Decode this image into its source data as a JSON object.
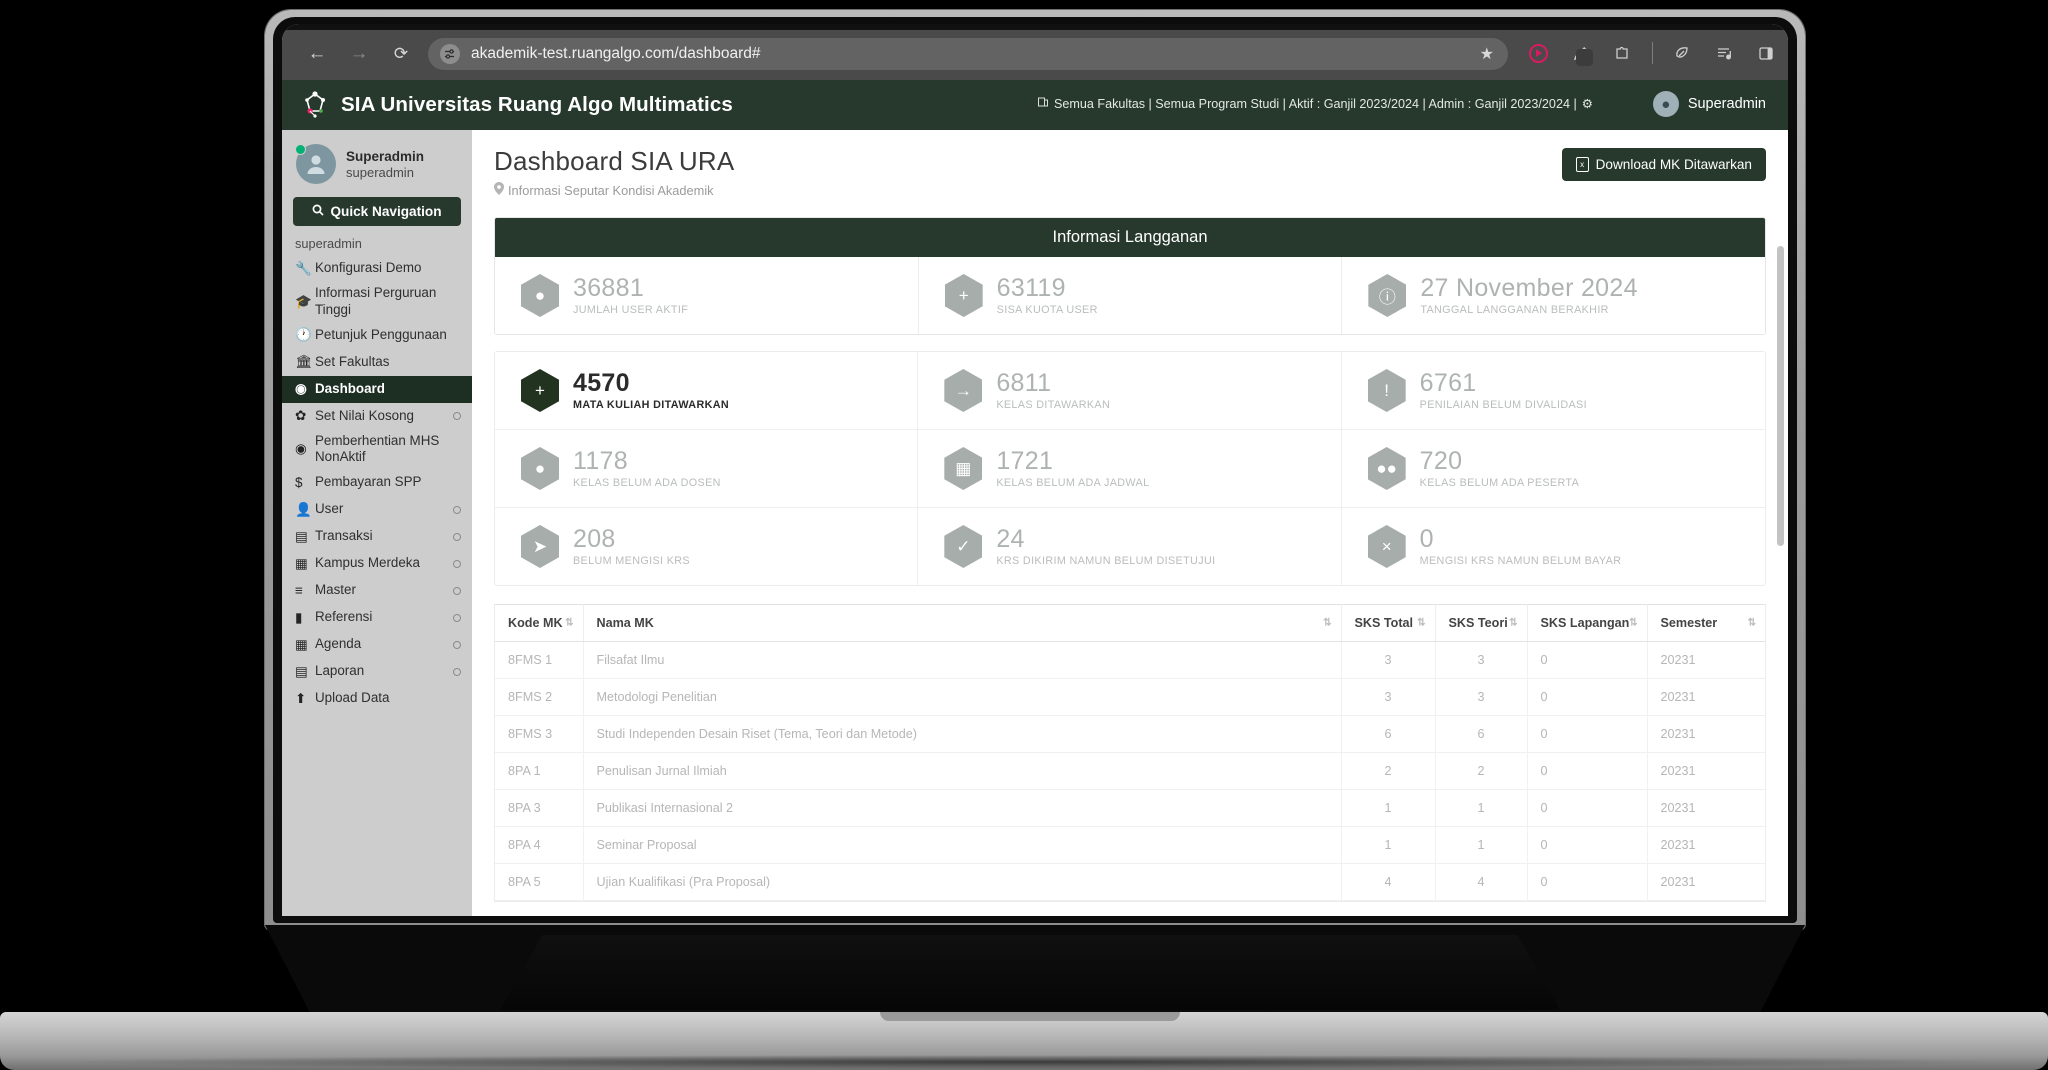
{
  "browser": {
    "back_icon": "←",
    "forward_icon": "→",
    "reload_icon": "⟳",
    "site_icon": "site-settings-icon",
    "url": "akademik-test.ruangalgo.com/dashboard#",
    "star_icon": "★",
    "extensions": [
      "record-icon",
      "pen-icon",
      "puzzle-icon",
      "leaf-icon",
      "playlist-icon",
      "side-panel-icon",
      "profile-icon"
    ],
    "menu_icon": "⋮"
  },
  "app_header": {
    "title": "SIA Universitas Ruang Algo Multimatics",
    "logo_icon": "network-graph-icon",
    "meta_icon": "building-icon",
    "meta": "Semua Fakultas | Semua Program Studi | Aktif : Ganjil 2023/2024 | Admin : Ganjil 2023/2024 |",
    "gear_icon": "⚙",
    "user_icon": "user-avatar-icon",
    "user_name": "Superadmin"
  },
  "sidebar": {
    "profile": {
      "name": "Superadmin",
      "username": "superadmin",
      "avatar_icon": "user-avatar-icon",
      "status": "online"
    },
    "quick_nav": {
      "label": "Quick Navigation",
      "icon": "search-icon"
    },
    "section_label": "superadmin",
    "items": [
      {
        "label": "Konfigurasi Demo",
        "icon": "wrench-icon",
        "icon_glyph": "🔧",
        "active": false,
        "has_submenu": false
      },
      {
        "label": "Informasi Perguruan Tinggi",
        "icon": "graduation-cap-icon",
        "icon_glyph": "🎓",
        "active": false,
        "has_submenu": false
      },
      {
        "label": "Petunjuk Penggunaan",
        "icon": "clock-icon",
        "icon_glyph": "🕐",
        "active": false,
        "has_submenu": false
      },
      {
        "label": "Set Fakultas",
        "icon": "bank-icon",
        "icon_glyph": "🏛",
        "active": false,
        "has_submenu": false
      },
      {
        "label": "Dashboard",
        "icon": "dashboard-icon",
        "icon_glyph": "◉",
        "active": true,
        "has_submenu": false
      },
      {
        "label": "Set Nilai Kosong",
        "icon": "gear-icon",
        "icon_glyph": "✿",
        "active": false,
        "has_submenu": true
      },
      {
        "label": "Pemberhentian MHS NonAktif",
        "icon": "target-icon",
        "icon_glyph": "◉",
        "active": false,
        "has_submenu": false
      },
      {
        "label": "Pembayaran SPP",
        "icon": "dollar-icon",
        "icon_glyph": "$",
        "active": false,
        "has_submenu": false
      },
      {
        "label": "User",
        "icon": "person-icon",
        "icon_glyph": "👤",
        "active": false,
        "has_submenu": true
      },
      {
        "label": "Transaksi",
        "icon": "list-document-icon",
        "icon_glyph": "▤",
        "active": false,
        "has_submenu": true
      },
      {
        "label": "Kampus Merdeka",
        "icon": "calendar-icon",
        "icon_glyph": "▦",
        "active": false,
        "has_submenu": true
      },
      {
        "label": "Master",
        "icon": "database-icon",
        "icon_glyph": "≡",
        "active": false,
        "has_submenu": true
      },
      {
        "label": "Referensi",
        "icon": "file-icon",
        "icon_glyph": "▮",
        "active": false,
        "has_submenu": true
      },
      {
        "label": "Agenda",
        "icon": "calendar-icon",
        "icon_glyph": "▦",
        "active": false,
        "has_submenu": true
      },
      {
        "label": "Laporan",
        "icon": "report-icon",
        "icon_glyph": "▤",
        "active": false,
        "has_submenu": true
      },
      {
        "label": "Upload Data",
        "icon": "upload-icon",
        "icon_glyph": "⬆",
        "active": false,
        "has_submenu": false
      }
    ]
  },
  "main": {
    "page_title": "Dashboard SIA URA",
    "page_subtitle": "Informasi Seputar Kondisi Akademik",
    "subtitle_icon": "location-pin-icon",
    "download_button": {
      "label": "Download MK Ditawarkan",
      "icon": "excel-file-icon",
      "icon_text": "x"
    },
    "subscription": {
      "title": "Informasi Langganan",
      "cells": [
        {
          "value": "36881",
          "label": "JUMLAH USER AKTIF",
          "icon": "user-icon",
          "glyph": "●"
        },
        {
          "value": "63119",
          "label": "SISA KUOTA USER",
          "icon": "plus-icon",
          "glyph": "+"
        },
        {
          "value": "27 November 2024",
          "label": "TANGGAL LANGGANAN BERAKHIR",
          "icon": "info-circle-icon",
          "glyph": "ⓘ"
        }
      ]
    },
    "stats": [
      {
        "value": "4570",
        "label": "MATA KULIAH DITAWARKAN",
        "icon": "plus-icon",
        "glyph": "+",
        "highlighted": true
      },
      {
        "value": "6811",
        "label": "KELAS DITAWARKAN",
        "icon": "login-arrow-icon",
        "glyph": "→",
        "highlighted": false
      },
      {
        "value": "6761",
        "label": "PENILAIAN BELUM DIVALIDASI",
        "icon": "exclamation-circle-icon",
        "glyph": "!",
        "highlighted": false
      },
      {
        "value": "1178",
        "label": "KELAS BELUM ADA DOSEN",
        "icon": "user-icon",
        "glyph": "●",
        "highlighted": false
      },
      {
        "value": "1721",
        "label": "KELAS BELUM ADA JADWAL",
        "icon": "calendar-icon",
        "glyph": "▦",
        "highlighted": false
      },
      {
        "value": "720",
        "label": "KELAS BELUM ADA PESERTA",
        "icon": "users-group-icon",
        "glyph": "●●",
        "highlighted": false
      },
      {
        "value": "208",
        "label": "BELUM MENGISI KRS",
        "icon": "paper-plane-icon",
        "glyph": "➤",
        "highlighted": false
      },
      {
        "value": "24",
        "label": "KRS DIKIRIM NAMUN BELUM DISETUJUI",
        "icon": "check-icon",
        "glyph": "✓",
        "highlighted": false
      },
      {
        "value": "0",
        "label": "MENGISI KRS NAMUN BELUM BAYAR",
        "icon": "close-x-icon",
        "glyph": "×",
        "highlighted": false
      }
    ],
    "table": {
      "columns": [
        "Kode MK",
        "Nama MK",
        "SKS Total",
        "SKS Teori",
        "SKS Lapangan",
        "Semester"
      ],
      "sort_icon": "sort-arrows-icon",
      "rows": [
        [
          "8FMS 1",
          "Filsafat Ilmu",
          "3",
          "3",
          "0",
          "20231"
        ],
        [
          "8FMS 2",
          "Metodologi Penelitian",
          "3",
          "3",
          "0",
          "20231"
        ],
        [
          "8FMS 3",
          "Studi Independen Desain Riset (Tema, Teori dan Metode)",
          "6",
          "6",
          "0",
          "20231"
        ],
        [
          "8PA 1",
          "Penulisan Jurnal Ilmiah",
          "2",
          "2",
          "0",
          "20231"
        ],
        [
          "8PA 3",
          "Publikasi Internasional 2",
          "1",
          "1",
          "0",
          "20231"
        ],
        [
          "8PA 4",
          "Seminar Proposal",
          "1",
          "1",
          "0",
          "20231"
        ],
        [
          "8PA 5",
          "Ujian Kualifikasi (Pra Proposal)",
          "4",
          "4",
          "0",
          "20231"
        ]
      ]
    }
  },
  "colors": {
    "brand_green": "#26392c",
    "sidebar_bg": "#cdcdcd",
    "active_nav": "#1d2e22",
    "hex_grey": "#a6adab",
    "hex_dark": "#22331f"
  }
}
